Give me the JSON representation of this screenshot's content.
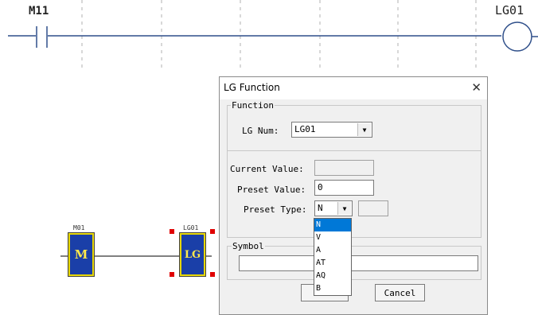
{
  "ladder": {
    "contact_label": "M11",
    "coil_label": "LG01"
  },
  "fbd": {
    "block_m": {
      "caption": "M01",
      "text": "M"
    },
    "block_lg": {
      "caption": "LG01",
      "text": "LG"
    },
    "colors": {
      "block_fill": "#1a3fa8",
      "block_border": "#e8d800",
      "block_text": "#ffe94a",
      "handles": "#e00000"
    }
  },
  "dialog": {
    "title": "LG Function",
    "close_glyph": "✕",
    "function_group": {
      "legend": "Function",
      "lg_num_label": "LG Num:",
      "lg_num_value": "LG01"
    },
    "current_value_label": "Current Value:",
    "current_value": "",
    "preset_value_label": "Preset Value:",
    "preset_value": "0",
    "preset_type_label": "Preset Type:",
    "preset_type_value": "N",
    "preset_type_options": [
      "N",
      "V",
      "A",
      "AT",
      "AQ",
      "B"
    ],
    "symbol_group": {
      "legend": "Symbol",
      "value": ""
    },
    "ok_label": "",
    "cancel_label": "Cancel"
  }
}
